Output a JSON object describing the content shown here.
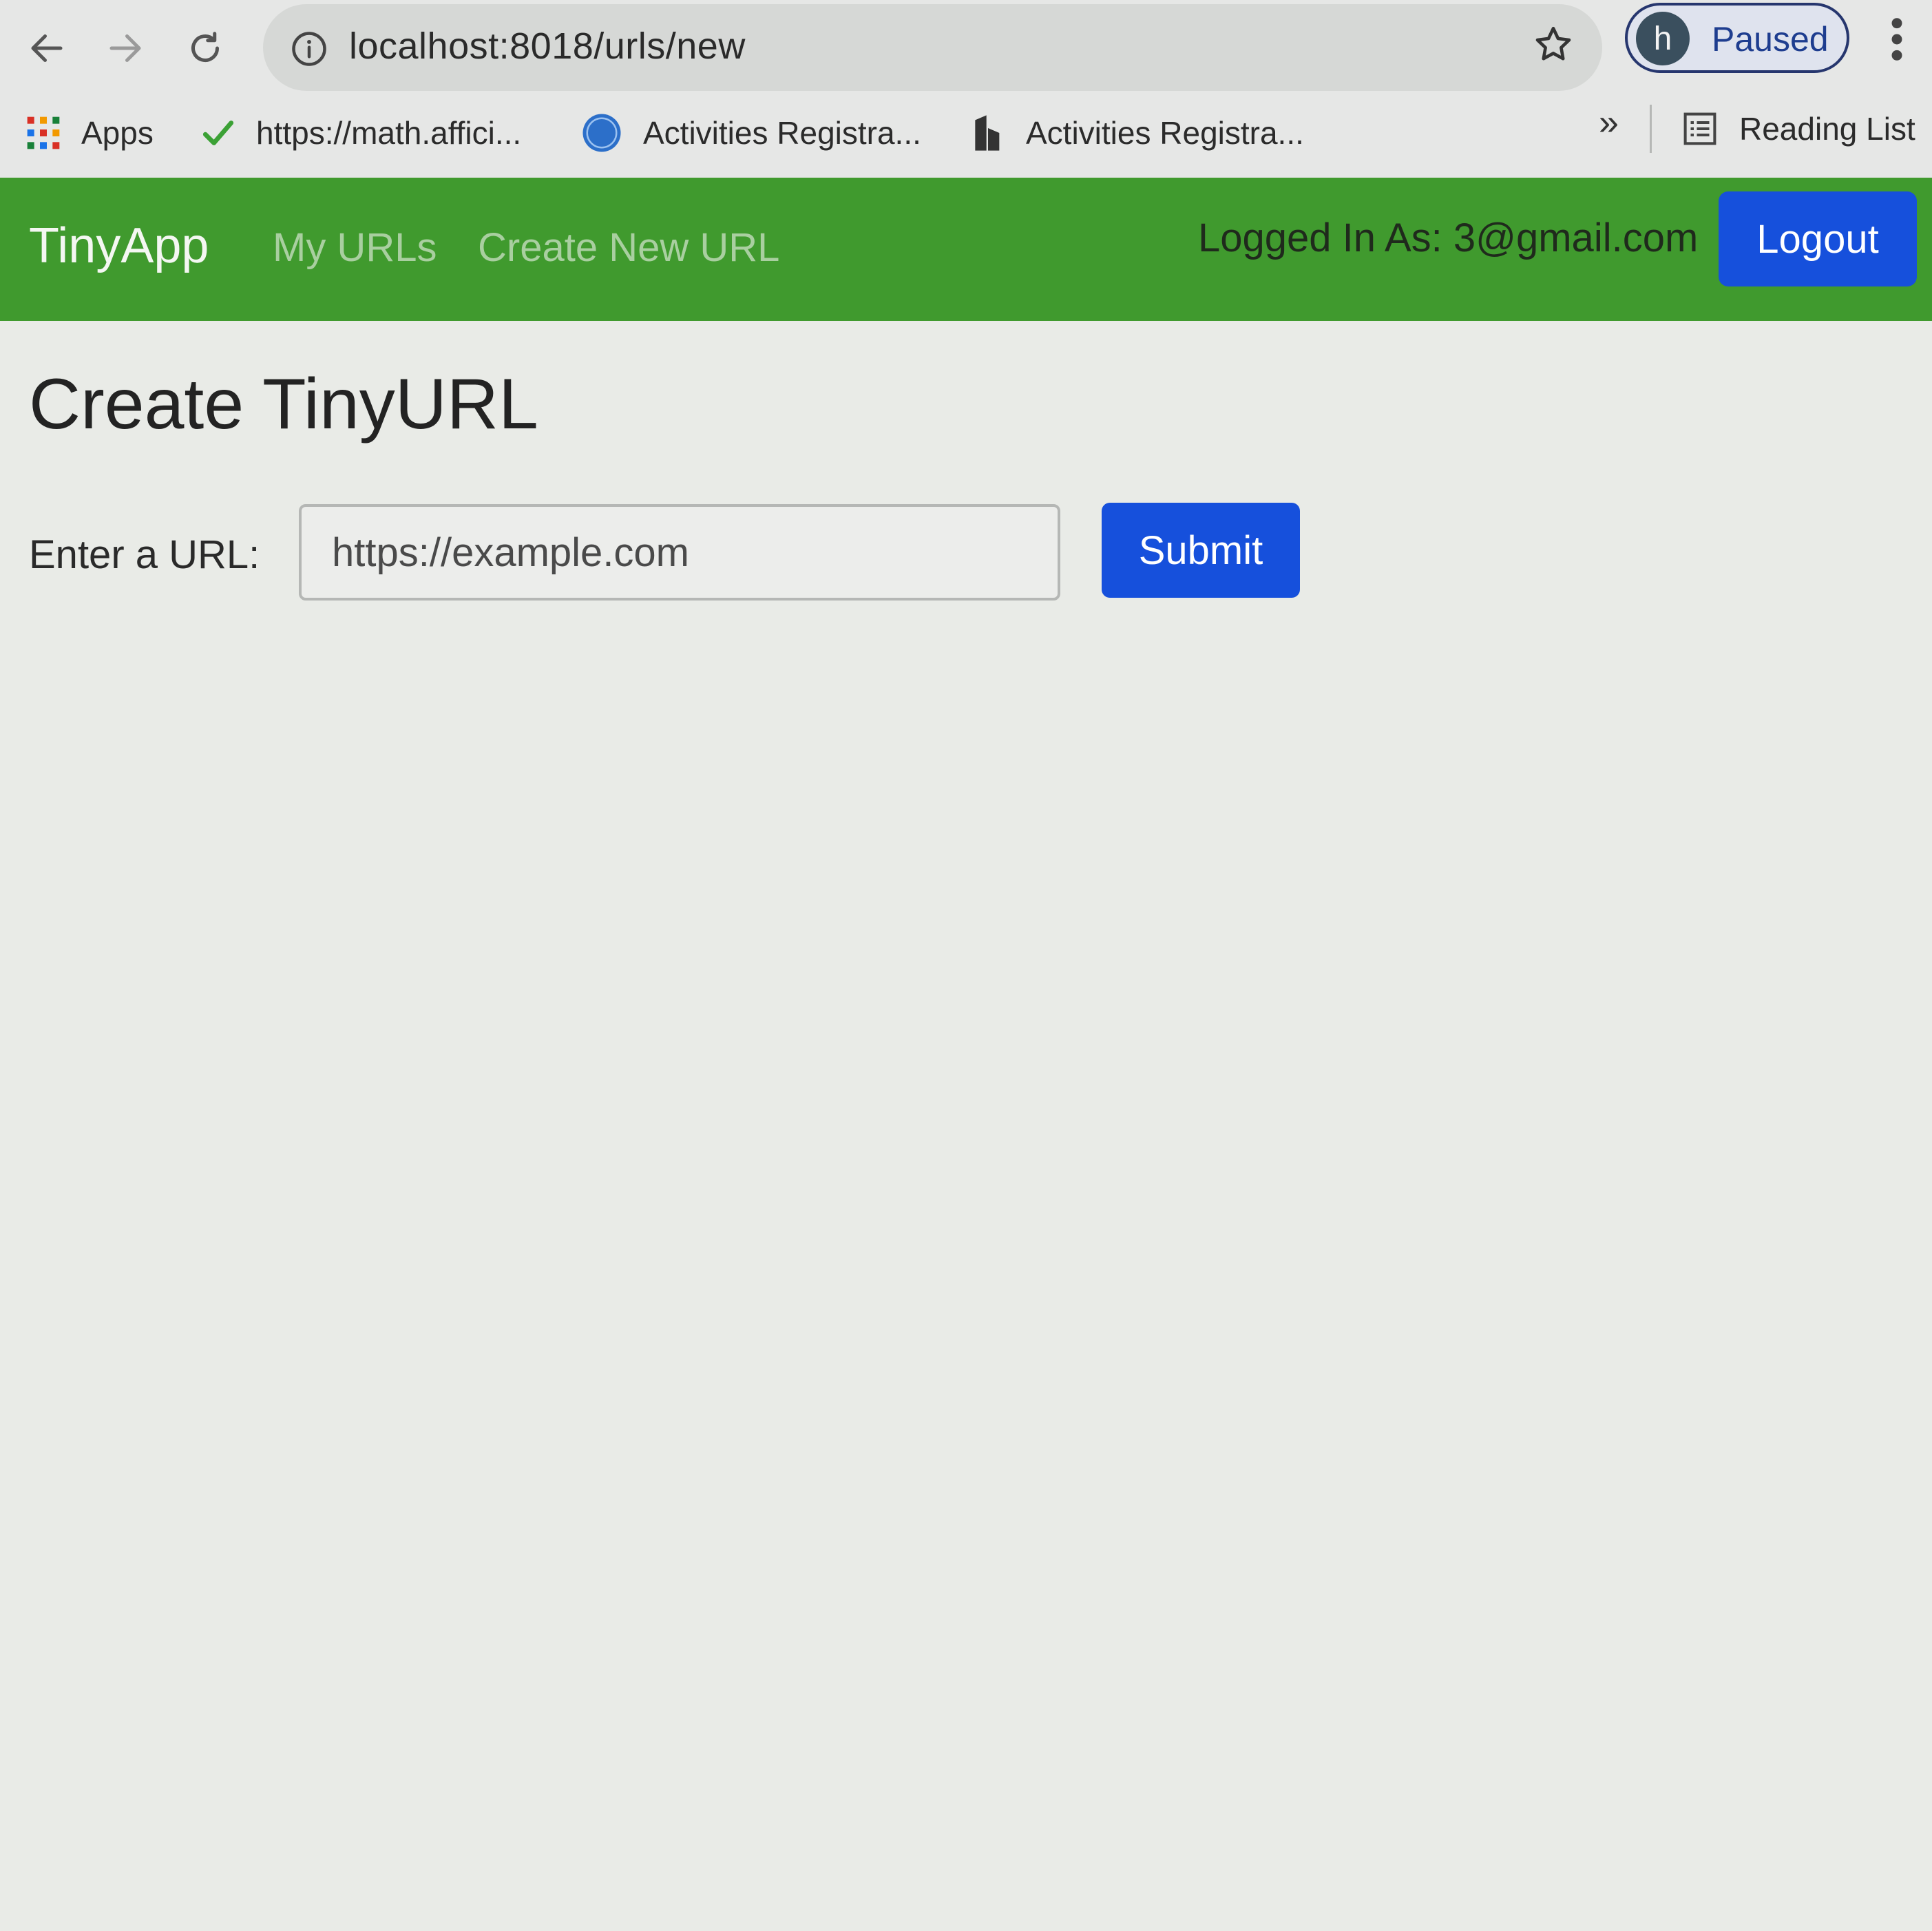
{
  "browser": {
    "url": "localhost:8018/urls/new",
    "profile": {
      "initial": "h",
      "status": "Paused"
    },
    "bookmarks": [
      {
        "label": "Apps",
        "icon": "apps-grid-icon"
      },
      {
        "label": "https://math.affici...",
        "icon": "green-checkmark-icon"
      },
      {
        "label": "Activities Registra...",
        "icon": "pm-logo-icon"
      },
      {
        "label": "Activities Registra...",
        "icon": "building-icon"
      }
    ],
    "more_bookmarks": "»",
    "reading_list": "Reading List"
  },
  "navbar": {
    "brand": "TinyApp",
    "links": [
      {
        "label": "My URLs"
      },
      {
        "label": "Create New URL"
      }
    ],
    "logged_in_text": "Logged In As: 3@gmail.com",
    "logout_label": "Logout"
  },
  "main": {
    "title": "Create TinyURL",
    "form": {
      "label": "Enter a URL:",
      "placeholder": "https://example.com",
      "submit_label": "Submit"
    }
  },
  "colors": {
    "navbar_green": "#409a2e",
    "button_blue": "#1650dc",
    "page_background": "#e9ebe7"
  }
}
